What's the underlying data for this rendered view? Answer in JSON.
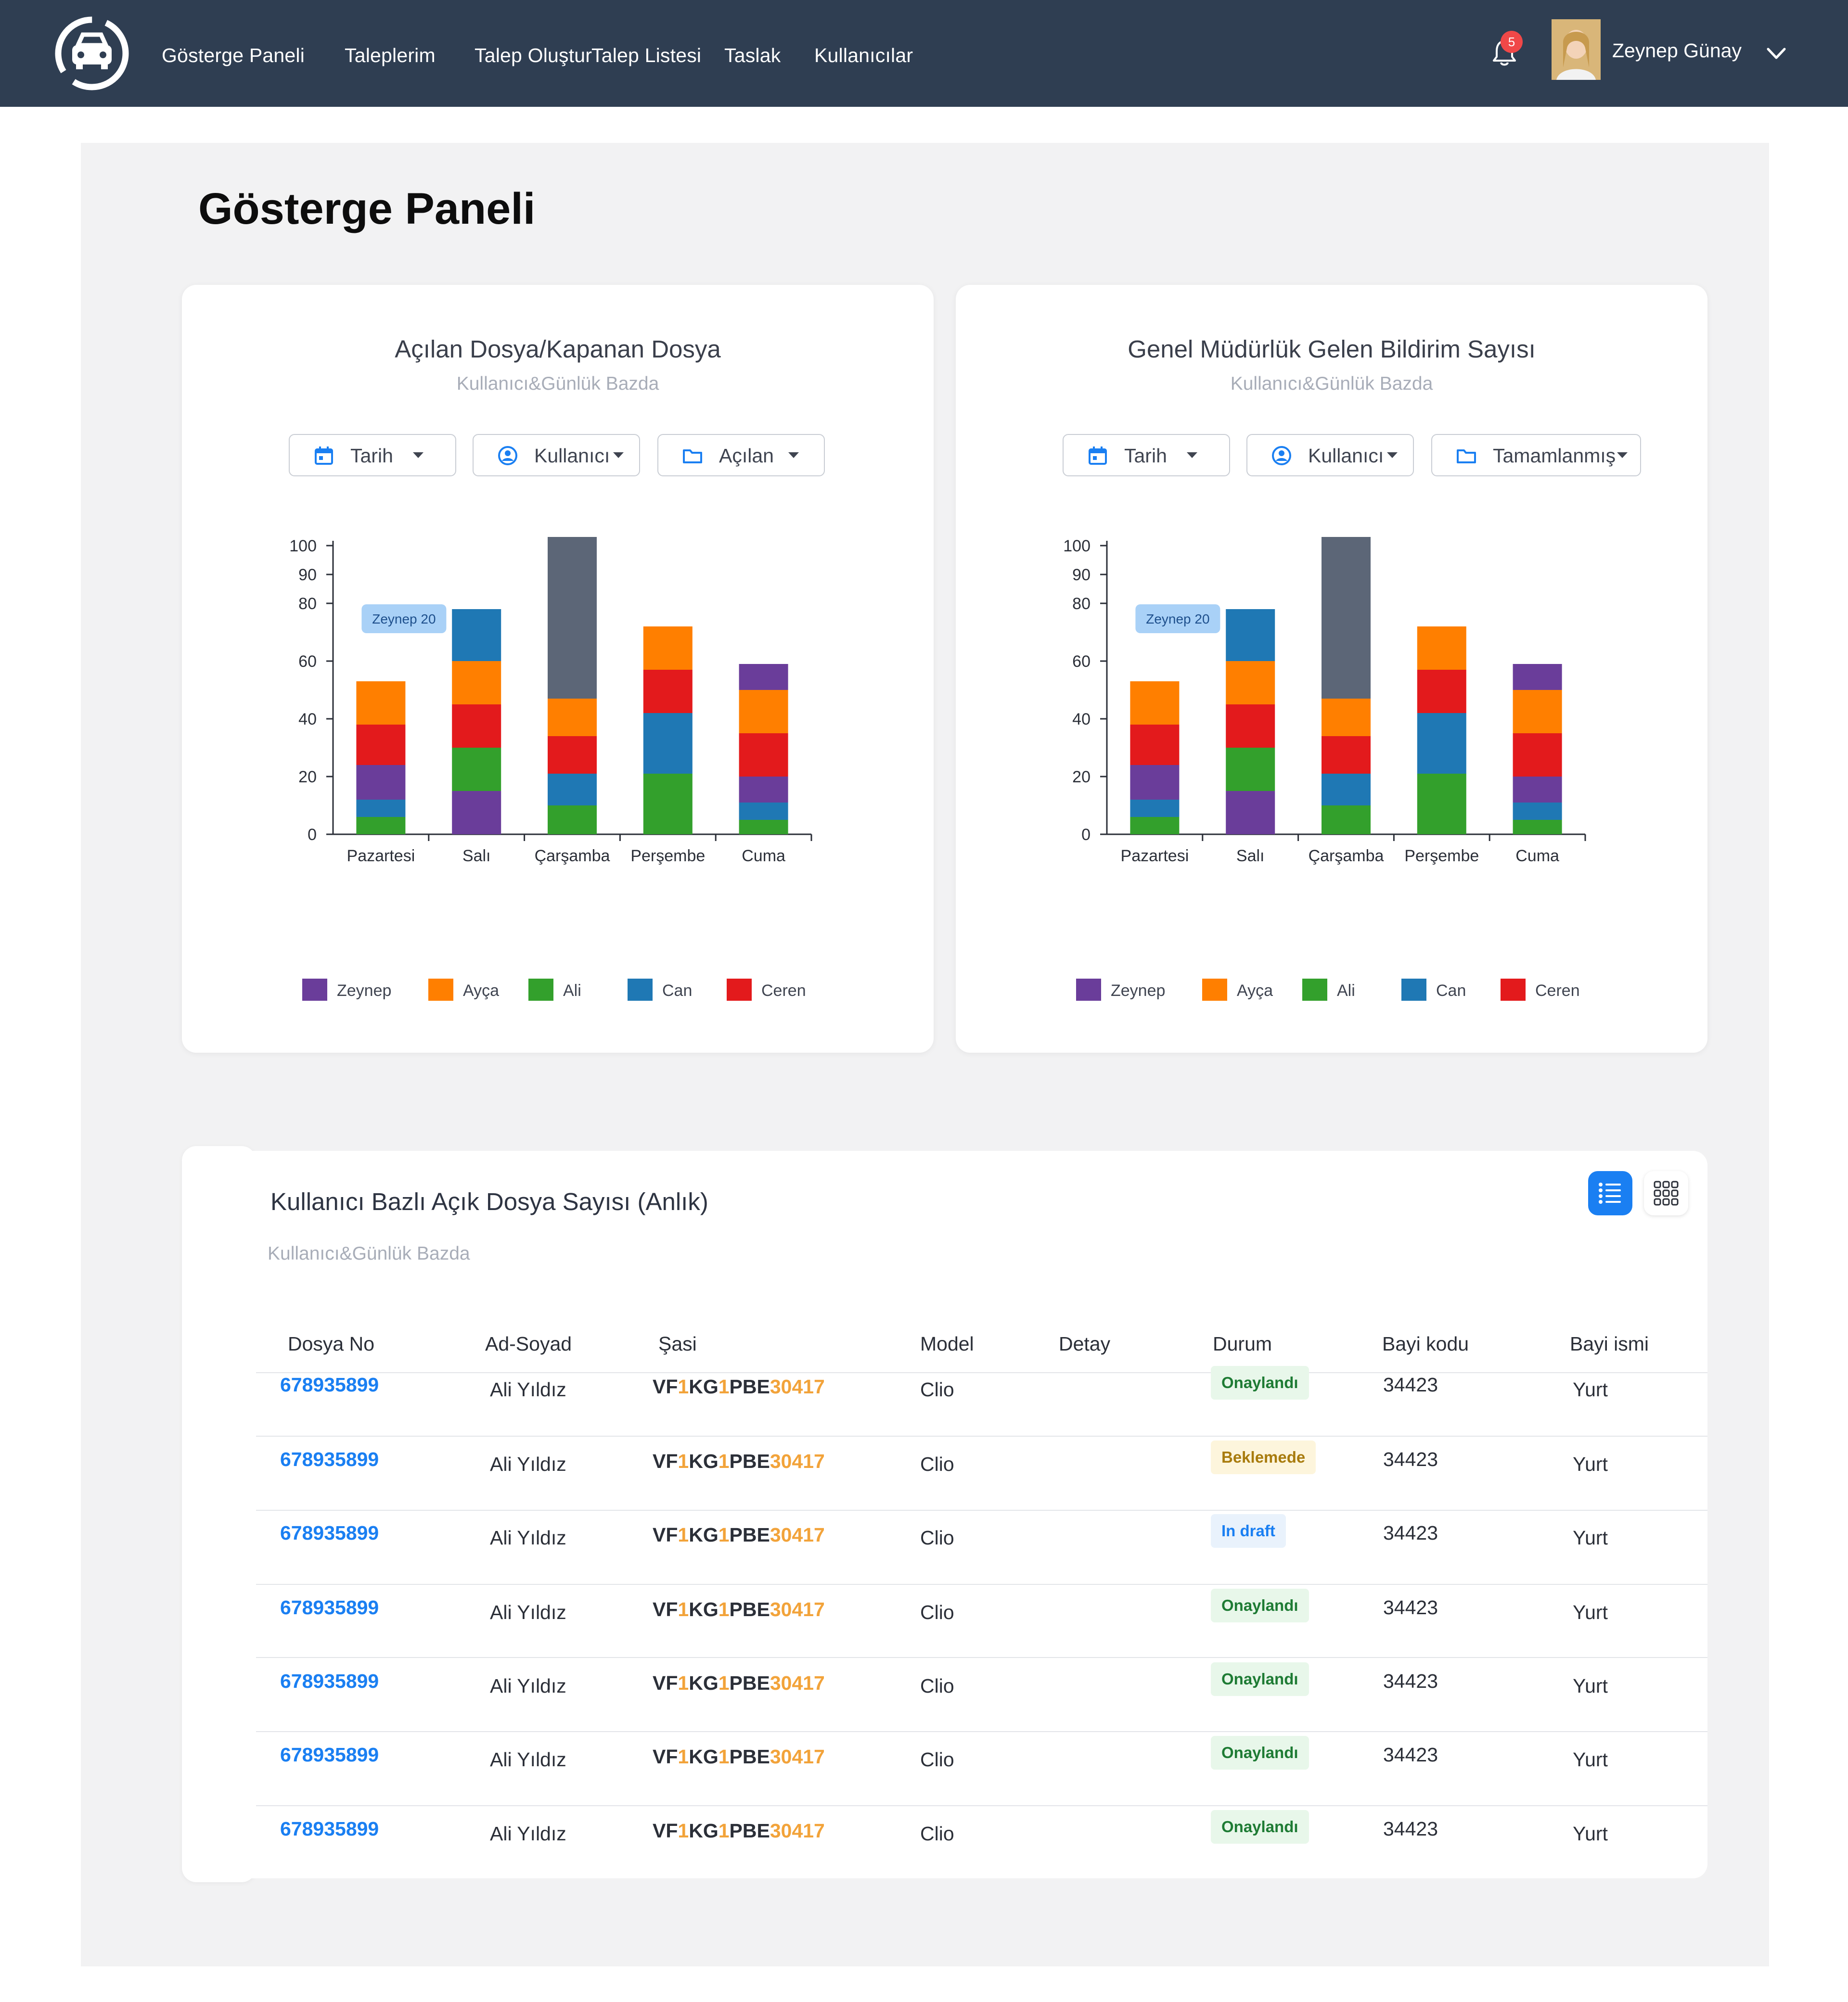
{
  "nav": {
    "items": [
      "Gösterge Paneli",
      "Taleplerim",
      "Talep Oluştur",
      "Talep Listesi",
      "Taslak",
      "Kullanıcılar"
    ],
    "notification_count": "5",
    "user_name": "Zeynep Günay"
  },
  "page": {
    "title": "Gösterge Paneli"
  },
  "cards": [
    {
      "title": "Açılan  Dosya/Kapanan Dosya",
      "subtitle": "Kullanıcı&Günlük Bazda",
      "filters": [
        "Tarih",
        "Kullanıcı",
        "Açılan"
      ],
      "filter_icons": [
        "calendar-icon",
        "user-circle-icon",
        "folder-icon"
      ]
    },
    {
      "title": "Genel Müdürlük Gelen Bildirim Sayısı",
      "subtitle": "Kullanıcı&Günlük Bazda",
      "filters": [
        "Tarih",
        "Kullanıcı",
        "Tamamlanmış"
      ],
      "filter_icons": [
        "calendar-icon",
        "user-circle-icon",
        "folder-icon"
      ]
    }
  ],
  "chart_data": [
    {
      "type": "bar",
      "stacked": true,
      "categories": [
        "Pazartesi",
        "Salı",
        "Çarşamba",
        "Perşembe",
        "Cuma"
      ],
      "ylim": [
        0,
        100
      ],
      "yticks": [
        0,
        20,
        40,
        60,
        80,
        90,
        100
      ],
      "series": [
        {
          "name": "Ali",
          "color": "#33a02c",
          "values": [
            6,
            0,
            10,
            21,
            5
          ]
        },
        {
          "name": "Can",
          "color": "#1f78b4",
          "values": [
            6,
            0,
            11,
            21,
            6
          ]
        },
        {
          "name": "Zeynep",
          "color": "#6a3d9a",
          "values": [
            12,
            15,
            0,
            0,
            9
          ]
        },
        {
          "name": "",
          "color": "#33a02c",
          "values": [
            0,
            15,
            0,
            0,
            0
          ]
        },
        {
          "name": "Ceren",
          "color": "#e31a1c",
          "values": [
            14,
            15,
            13,
            15,
            15
          ]
        },
        {
          "name": "Ayça",
          "color": "#ff7f00",
          "values": [
            15,
            15,
            13,
            15,
            15
          ]
        },
        {
          "name": "",
          "color": "#1f78b4",
          "values": [
            0,
            18,
            0,
            0,
            0
          ]
        },
        {
          "name": "",
          "color": "#6a3d9a",
          "values": [
            0,
            0,
            0,
            0,
            9
          ]
        },
        {
          "name": "",
          "color": "#5c6677",
          "values": [
            0,
            0,
            56,
            0,
            0
          ]
        }
      ],
      "legend": [
        {
          "name": "Zeynep",
          "color": "#6a3d9a"
        },
        {
          "name": "Ayça",
          "color": "#ff7f00"
        },
        {
          "name": "Ali",
          "color": "#33a02c"
        },
        {
          "name": "Can",
          "color": "#1f78b4"
        },
        {
          "name": "Ceren",
          "color": "#e31a1c"
        }
      ],
      "legend_placement": "bottom",
      "tooltip": {
        "text": "Zeynep 20",
        "category": "Pazartesi"
      }
    },
    {
      "type": "bar",
      "stacked": true,
      "categories": [
        "Pazartesi",
        "Salı",
        "Çarşamba",
        "Perşembe",
        "Cuma"
      ],
      "ylim": [
        0,
        100
      ],
      "yticks": [
        0,
        20,
        40,
        60,
        80,
        90,
        100
      ],
      "series": [
        {
          "name": "Ali",
          "color": "#33a02c",
          "values": [
            6,
            0,
            10,
            21,
            5
          ]
        },
        {
          "name": "Can",
          "color": "#1f78b4",
          "values": [
            6,
            0,
            11,
            21,
            6
          ]
        },
        {
          "name": "Zeynep",
          "color": "#6a3d9a",
          "values": [
            12,
            15,
            0,
            0,
            9
          ]
        },
        {
          "name": "",
          "color": "#33a02c",
          "values": [
            0,
            15,
            0,
            0,
            0
          ]
        },
        {
          "name": "Ceren",
          "color": "#e31a1c",
          "values": [
            14,
            15,
            13,
            15,
            15
          ]
        },
        {
          "name": "Ayça",
          "color": "#ff7f00",
          "values": [
            15,
            15,
            13,
            15,
            15
          ]
        },
        {
          "name": "",
          "color": "#1f78b4",
          "values": [
            0,
            18,
            0,
            0,
            0
          ]
        },
        {
          "name": "",
          "color": "#6a3d9a",
          "values": [
            0,
            0,
            0,
            0,
            9
          ]
        },
        {
          "name": "",
          "color": "#5c6677",
          "values": [
            0,
            0,
            56,
            0,
            0
          ]
        }
      ],
      "legend": [
        {
          "name": "Zeynep",
          "color": "#6a3d9a"
        },
        {
          "name": "Ayça",
          "color": "#ff7f00"
        },
        {
          "name": "Ali",
          "color": "#33a02c"
        },
        {
          "name": "Can",
          "color": "#1f78b4"
        },
        {
          "name": "Ceren",
          "color": "#e31a1c"
        }
      ],
      "legend_placement": "bottom",
      "tooltip": {
        "text": "Zeynep 20",
        "category": "Pazartesi"
      }
    }
  ],
  "table": {
    "title": "Kullanıcı Bazlı Açık Dosya Sayısı (Anlık)",
    "subtitle": "Kullanıcı&Günlük Bazda",
    "headers": [
      "Dosya No",
      "Ad-Soyad",
      "Şasi",
      "Model",
      "Detay",
      "Durum",
      "Bayi kodu",
      "Bayi ismi"
    ],
    "rows": [
      {
        "file_no": "678935899",
        "name": "Ali Yıldız",
        "vin": [
          "VF",
          "1",
          "KG",
          "1",
          "PBE",
          "30417"
        ],
        "model": "Clio",
        "detail": "",
        "status": "Onaylandı",
        "status_type": "approved",
        "dealer_code": "34423",
        "dealer_name": "Yurt"
      },
      {
        "file_no": "678935899",
        "name": "Ali Yıldız",
        "vin": [
          "VF",
          "1",
          "KG",
          "1",
          "PBE",
          "30417"
        ],
        "model": "Clio",
        "detail": "",
        "status": "Beklemede",
        "status_type": "pending",
        "dealer_code": "34423",
        "dealer_name": "Yurt"
      },
      {
        "file_no": "678935899",
        "name": "Ali Yıldız",
        "vin": [
          "VF",
          "1",
          "KG",
          "1",
          "PBE",
          "30417"
        ],
        "model": "Clio",
        "detail": "",
        "status": "In draft",
        "status_type": "draft",
        "dealer_code": "34423",
        "dealer_name": "Yurt"
      },
      {
        "file_no": "678935899",
        "name": "Ali Yıldız",
        "vin": [
          "VF",
          "1",
          "KG",
          "1",
          "PBE",
          "30417"
        ],
        "model": "Clio",
        "detail": "",
        "status": "Onaylandı",
        "status_type": "approved",
        "dealer_code": "34423",
        "dealer_name": "Yurt"
      },
      {
        "file_no": "678935899",
        "name": "Ali Yıldız",
        "vin": [
          "VF",
          "1",
          "KG",
          "1",
          "PBE",
          "30417"
        ],
        "model": "Clio",
        "detail": "",
        "status": "Onaylandı",
        "status_type": "approved",
        "dealer_code": "34423",
        "dealer_name": "Yurt"
      },
      {
        "file_no": "678935899",
        "name": "Ali Yıldız",
        "vin": [
          "VF",
          "1",
          "KG",
          "1",
          "PBE",
          "30417"
        ],
        "model": "Clio",
        "detail": "",
        "status": "Onaylandı",
        "status_type": "approved",
        "dealer_code": "34423",
        "dealer_name": "Yurt"
      },
      {
        "file_no": "678935899",
        "name": "Ali Yıldız",
        "vin": [
          "VF",
          "1",
          "KG",
          "1",
          "PBE",
          "30417"
        ],
        "model": "Clio",
        "detail": "",
        "status": "Onaylandı",
        "status_type": "approved",
        "dealer_code": "34423",
        "dealer_name": "Yurt"
      }
    ]
  },
  "status_colors": {
    "approved": {
      "bg": "#e8f7ea",
      "fg": "#1e7b34"
    },
    "pending": {
      "bg": "#fdf5dc",
      "fg": "#a87b0d"
    },
    "draft": {
      "bg": "#e9f2fc",
      "fg": "#1a7ff2"
    }
  },
  "colors": {
    "nav_bg": "#2f3e52",
    "accent": "#1a7ff2",
    "vin_highlight": "#f2a33a"
  }
}
